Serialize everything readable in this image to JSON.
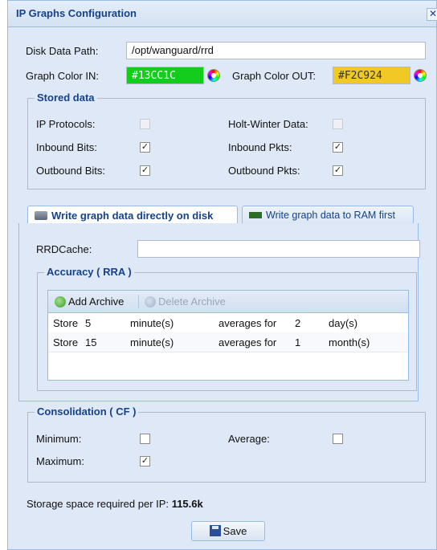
{
  "window": {
    "title": "IP Graphs Configuration",
    "close_glyph": "✕"
  },
  "form": {
    "disk_label": "Disk Data Path:",
    "disk_value": "/opt/wanguard/rrd",
    "color_in_label": "Graph Color IN:",
    "color_in_value": "#13CC1C",
    "color_out_label": "Graph Color OUT:",
    "color_out_value": "#F2C924"
  },
  "stored": {
    "legend": "Stored data",
    "ip_protocols": "IP Protocols:",
    "holt_winter": "Holt-Winter Data:",
    "inbound_bits": "Inbound Bits:",
    "inbound_pkts": "Inbound Pkts:",
    "outbound_bits": "Outbound Bits:",
    "outbound_pkts": "Outbound Pkts:",
    "checks": {
      "ip_protocols": false,
      "holt_winter": false,
      "inbound_bits": true,
      "inbound_pkts": true,
      "outbound_bits": true,
      "outbound_pkts": true
    }
  },
  "tabs": [
    {
      "label": "Write graph data directly on disk",
      "icon": "disk-icon"
    },
    {
      "label": "Write graph data to RAM first",
      "icon": "ram-icon"
    }
  ],
  "rrd": {
    "label": "RRDCache:",
    "value": ""
  },
  "accuracy": {
    "legend": "Accuracy ( RRA )",
    "add_label": "Add Archive",
    "delete_label": "Delete Archive",
    "rows": [
      {
        "store": "Store",
        "n": "5",
        "unit": "minute(s)",
        "avg": "averages for",
        "m": "2",
        "period": "day(s)"
      },
      {
        "store": "Store",
        "n": "15",
        "unit": "minute(s)",
        "avg": "averages for",
        "m": "1",
        "period": "month(s)"
      }
    ]
  },
  "consolidation": {
    "legend": "Consolidation ( CF )",
    "minimum": "Minimum:",
    "average": "Average:",
    "maximum": "Maximum:",
    "checks": {
      "minimum": false,
      "average": false,
      "maximum": true
    }
  },
  "storage": {
    "label": "Storage space required per IP:",
    "value": "115.6k"
  },
  "save_label": "Save",
  "check_glyph": "✓",
  "colors": {
    "accent": "#15428b",
    "in": "#13CC1C",
    "out": "#F2C924"
  }
}
